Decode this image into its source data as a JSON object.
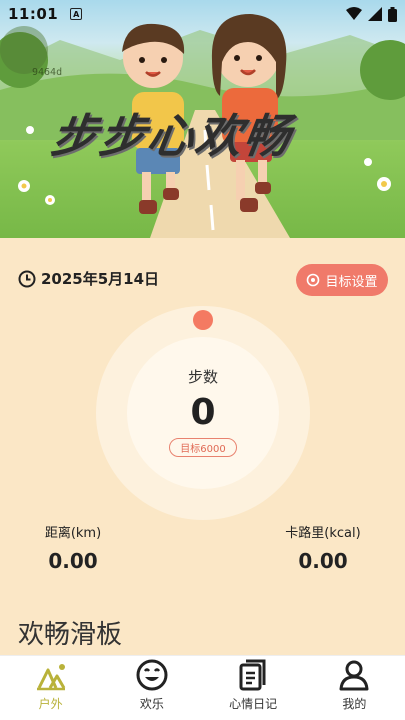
{
  "status": {
    "time": "11:01",
    "mode_letter": "A"
  },
  "hero": {
    "title": "步步心欢畅",
    "watermark_code": "9464d"
  },
  "date": {
    "text": "2025年5月14日"
  },
  "goal_button": {
    "label": "目标设置"
  },
  "steps": {
    "label": "步数",
    "value": "0",
    "target": "目标6000",
    "progress": 0
  },
  "metrics": {
    "distance": {
      "label": "距离(km)",
      "value": "0.00"
    },
    "calories": {
      "label": "卡路里(kcal)",
      "value": "0.00"
    }
  },
  "section": {
    "title": "欢畅滑板"
  },
  "tabs": [
    {
      "label": "户外",
      "icon": "outdoor-icon",
      "active": true
    },
    {
      "label": "欢乐",
      "icon": "smile-icon",
      "active": false
    },
    {
      "label": "心情日记",
      "icon": "diary-icon",
      "active": false
    },
    {
      "label": "我的",
      "icon": "user-icon",
      "active": false
    }
  ],
  "colors": {
    "accent": "#f07a6a",
    "background": "#fbe7c6",
    "active_tab": "#b9b23a"
  }
}
